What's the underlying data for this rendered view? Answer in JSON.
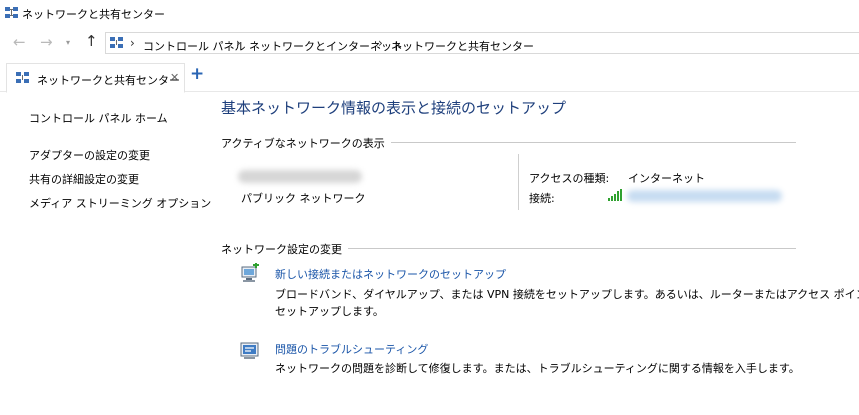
{
  "window": {
    "title": "ネットワークと共有センター"
  },
  "address_bar": {
    "breadcrumbs": [
      "コントロール パネル",
      "ネットワークとインターネット",
      "ネットワークと共有センター"
    ]
  },
  "tab": {
    "label": "ネットワークと共有センター"
  },
  "left_pane": {
    "home_link": "コントロール パネル ホーム",
    "links": [
      "アダプターの設定の変更",
      "共有の詳細設定の変更",
      "メディア ストリーミング オプション"
    ]
  },
  "main": {
    "heading": "基本ネットワーク情報の表示と接続のセットアップ",
    "active_networks": {
      "section_label": "アクティブなネットワークの表示",
      "network_type": "パブリック ネットワーク",
      "access_type_label": "アクセスの種類:",
      "access_type_value": "インターネット",
      "connection_label": "接続:"
    },
    "change_settings": {
      "section_label": "ネットワーク設定の変更",
      "items": [
        {
          "title": "新しい接続またはネットワークのセットアップ",
          "desc_line1": "ブロードバンド、ダイヤルアップ、または VPN 接続をセットアップします。あるいは、ルーターまたはアクセス ポイントを",
          "desc_line2": "セットアップします。"
        },
        {
          "title": "問題のトラブルシューティング",
          "desc_line1": "ネットワークの問題を診断して修復します。または、トラブルシューティングに関する情報を入手します。"
        }
      ]
    }
  }
}
